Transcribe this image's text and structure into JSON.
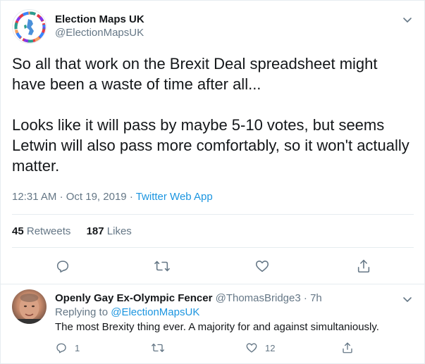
{
  "tweet": {
    "display_name": "Election Maps UK",
    "handle": "@ElectionMapsUK",
    "text_p1": "So all that work on the Brexit Deal spreadsheet might have been a waste of time after all...",
    "text_p2": "Looks like it will pass by maybe 5-10 votes, but seems Letwin will also pass more comfortably, so it won't actually matter.",
    "time": "12:31 AM",
    "date": "Oct 19, 2019",
    "separator": "·",
    "app": "Twitter Web App",
    "retweets_count": "45",
    "retweets_label": "Retweets",
    "likes_count": "187",
    "likes_label": "Likes",
    "icons": [
      "reply-icon",
      "retweet-icon",
      "like-icon",
      "share-icon",
      "chevron-down-icon"
    ]
  },
  "reply": {
    "display_name": "Openly Gay Ex-Olympic Fencer",
    "handle": "@ThomasBridge3",
    "separator": "·",
    "time": "7h",
    "replying_prefix": "Replying to",
    "replying_to": "@ElectionMapsUK",
    "text": "The most Brexity thing ever. A majority for and against simultaniously.",
    "reply_count": "1",
    "like_count": "12"
  },
  "colors": {
    "text": "#14171a",
    "secondary": "#657786",
    "link": "#1b95e0",
    "border": "#e6ecf0"
  }
}
